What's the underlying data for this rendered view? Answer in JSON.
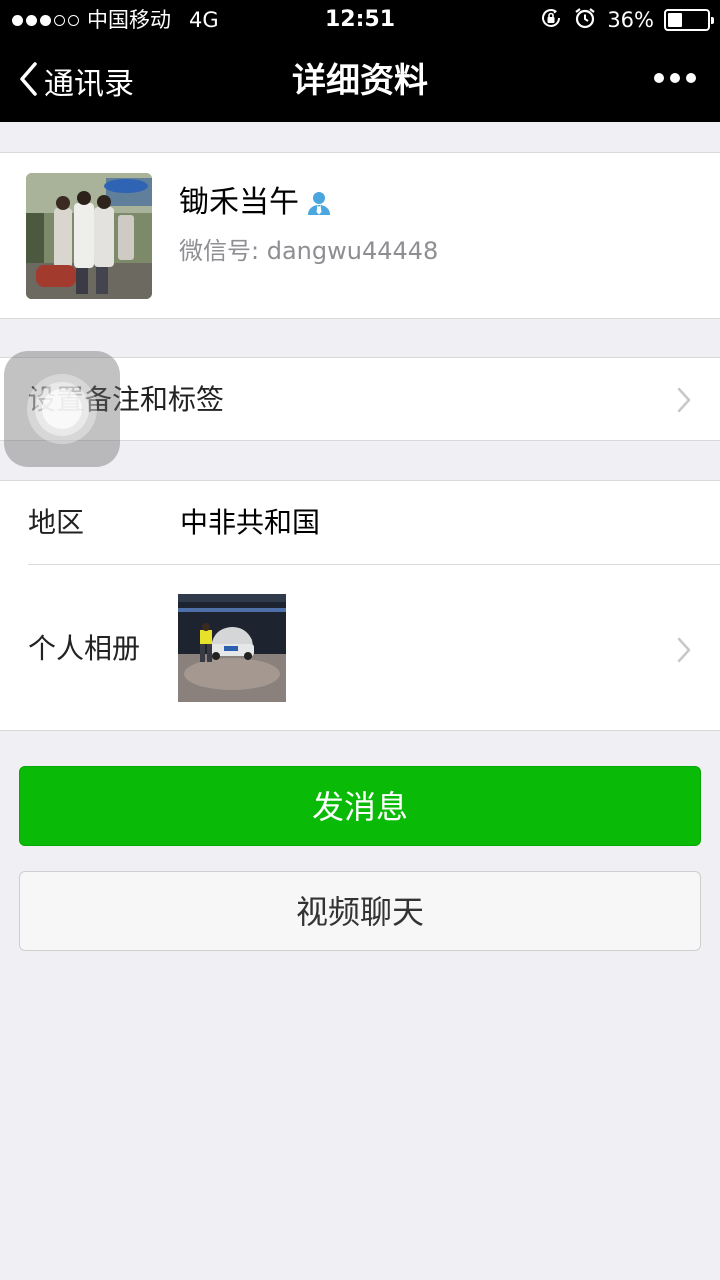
{
  "status_bar": {
    "carrier": "中国移动",
    "network": "4G",
    "time": "12:51",
    "battery_percent": "36%",
    "battery_level": 0.36,
    "signal_full_dots": 3,
    "signal_total_dots": 5
  },
  "nav": {
    "back_label": "通讯录",
    "title": "详细资料",
    "more_icon": "more-dots-icon"
  },
  "profile": {
    "name": "锄禾当午",
    "wechat_id_label": "微信号:",
    "wechat_id": "dangwu44448",
    "verify_icon": "person-icon"
  },
  "remark": {
    "label": "设置备注和标签"
  },
  "info": {
    "region_label": "地区",
    "region_value": "中非共和国",
    "album_label": "个人相册"
  },
  "actions": {
    "send_message": "发消息",
    "video_chat": "视频聊天"
  },
  "colors": {
    "nav_background": "#000000",
    "page_background": "#efeff4",
    "primary_button": "#09bb07",
    "secondary_text": "#8e8e93"
  }
}
